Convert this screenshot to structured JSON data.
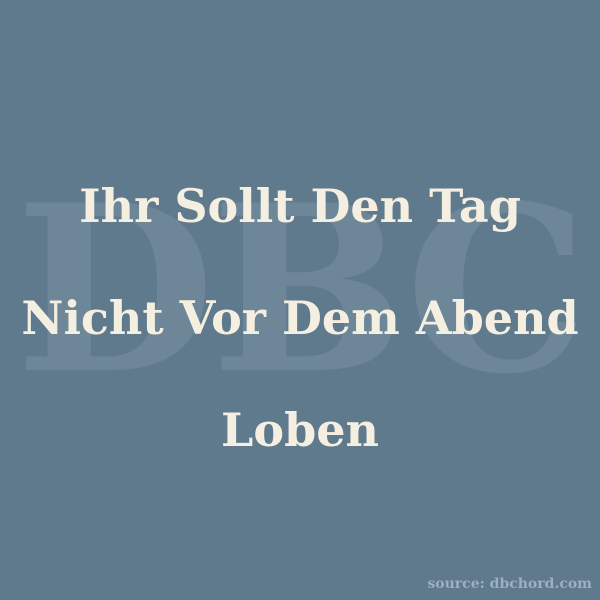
{
  "watermark": {
    "text": "DBC"
  },
  "quote": {
    "lines": [
      "Ihr Sollt Den Tag",
      "Nicht Vor Dem Abend",
      "Loben"
    ]
  },
  "footer": {
    "source": "source: dbchord.com"
  },
  "colors": {
    "background": "#5f7a8d",
    "text": "#f5efe1",
    "watermark": "#7a93a3",
    "source": "#9cb0bf"
  }
}
